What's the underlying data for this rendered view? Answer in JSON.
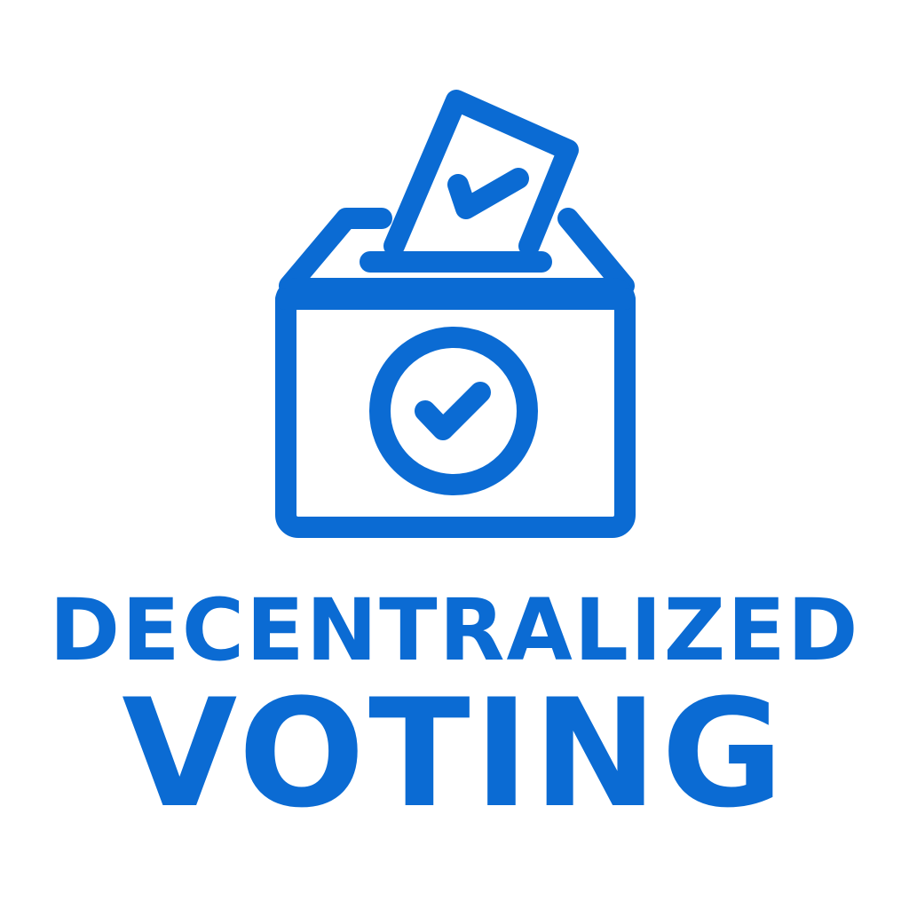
{
  "brand": {
    "accent_color": "#0B6BD3",
    "background_color": "#FFFFFF",
    "icon": "ballot-box-icon",
    "title_line_1": "DECENTRALIZED",
    "title_line_2": "VOTING"
  }
}
